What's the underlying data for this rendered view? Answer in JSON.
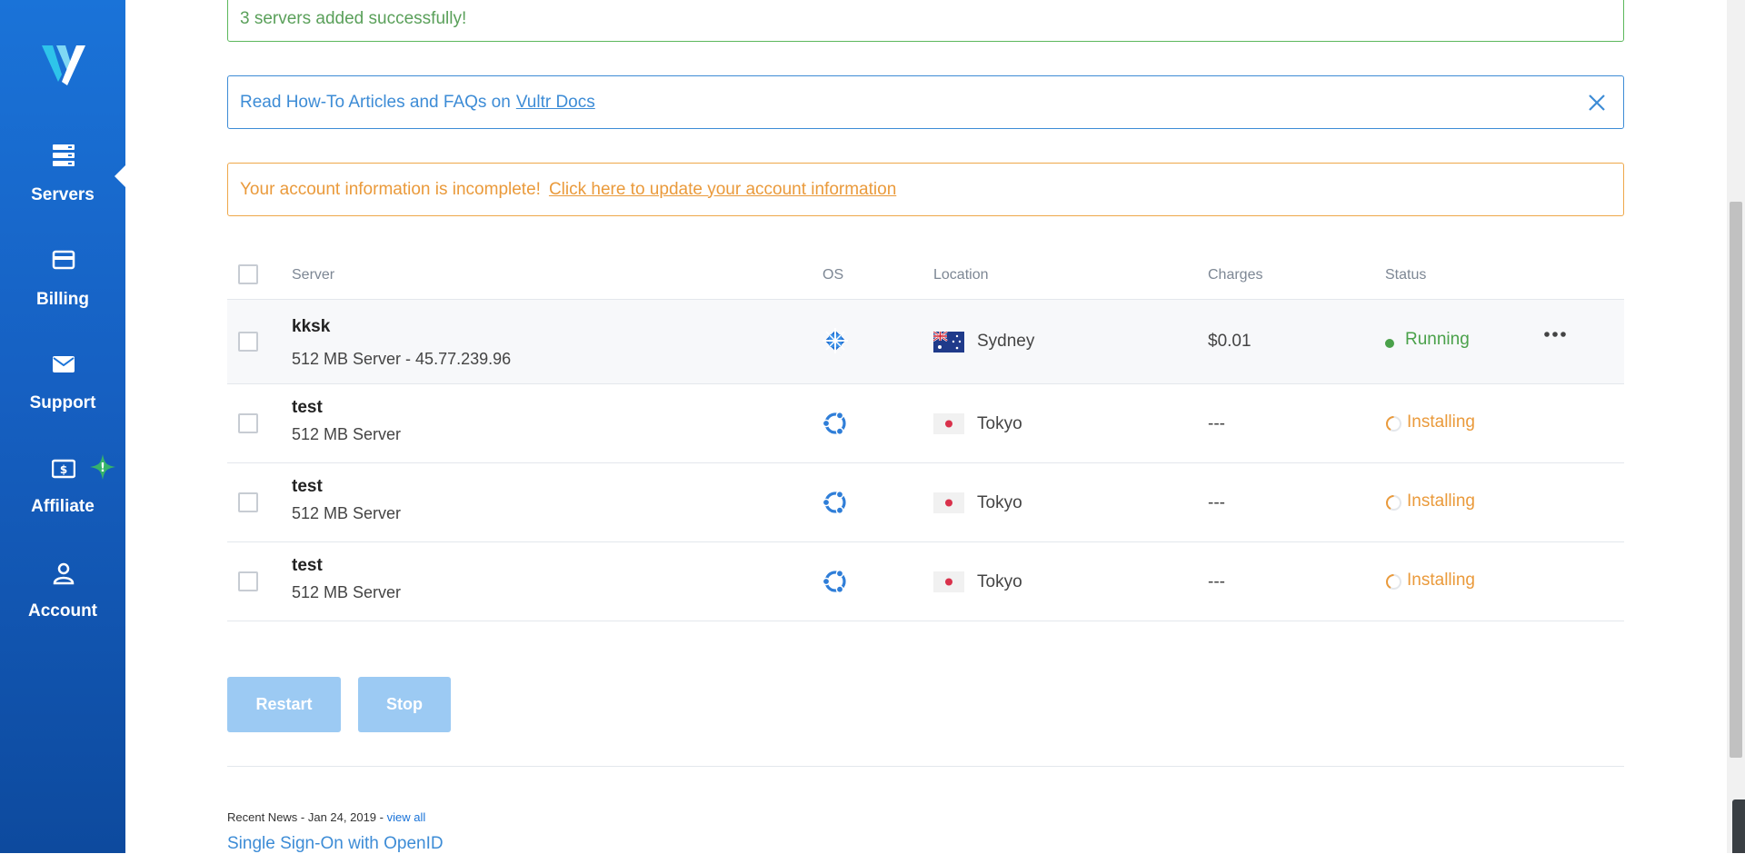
{
  "sidebar": {
    "logo": "V",
    "items": [
      {
        "label": "Servers",
        "icon": "servers-icon",
        "active": true
      },
      {
        "label": "Billing",
        "icon": "credit-card-icon"
      },
      {
        "label": "Support",
        "icon": "envelope-icon"
      },
      {
        "label": "Affiliate",
        "icon": "dollar-bill-icon",
        "badge": "!"
      },
      {
        "label": "Account",
        "icon": "user-icon"
      }
    ]
  },
  "alerts": {
    "success": "3 servers added successfully!",
    "info_text": "Read How-To Articles and FAQs on",
    "info_link": "Vultr Docs",
    "warning_text": "Your account information is incomplete!",
    "warning_link": "Click here to update your account information"
  },
  "table": {
    "headers": {
      "server": "Server",
      "os": "OS",
      "location": "Location",
      "charges": "Charges",
      "status": "Status"
    },
    "rows": [
      {
        "name": "kksk",
        "desc": "512 MB Server - 45.77.239.96",
        "os": "centos-icon",
        "flag": "australia-flag",
        "location": "Sydney",
        "charges": "$0.01",
        "status": "Running"
      },
      {
        "name": "test",
        "desc": "512 MB Server",
        "os": "ubuntu-icon",
        "flag": "japan-flag",
        "location": "Tokyo",
        "charges": "---",
        "status": "Installing"
      },
      {
        "name": "test",
        "desc": "512 MB Server",
        "os": "ubuntu-icon",
        "flag": "japan-flag",
        "location": "Tokyo",
        "charges": "---",
        "status": "Installing"
      },
      {
        "name": "test",
        "desc": "512 MB Server",
        "os": "ubuntu-icon",
        "flag": "japan-flag",
        "location": "Tokyo",
        "charges": "---",
        "status": "Installing"
      }
    ]
  },
  "actions": {
    "restart": "Restart",
    "stop": "Stop"
  },
  "news": {
    "meta": "Recent News - Jan 24, 2019 -",
    "view_all": "view all",
    "title": "Single Sign-On with OpenID"
  },
  "colors": {
    "sidebar_blue": "#1a73d8",
    "success": "#5cb85c",
    "info": "#3d8cd6",
    "warning": "#ea9a3b",
    "button_disabled": "#9ccaf3"
  }
}
